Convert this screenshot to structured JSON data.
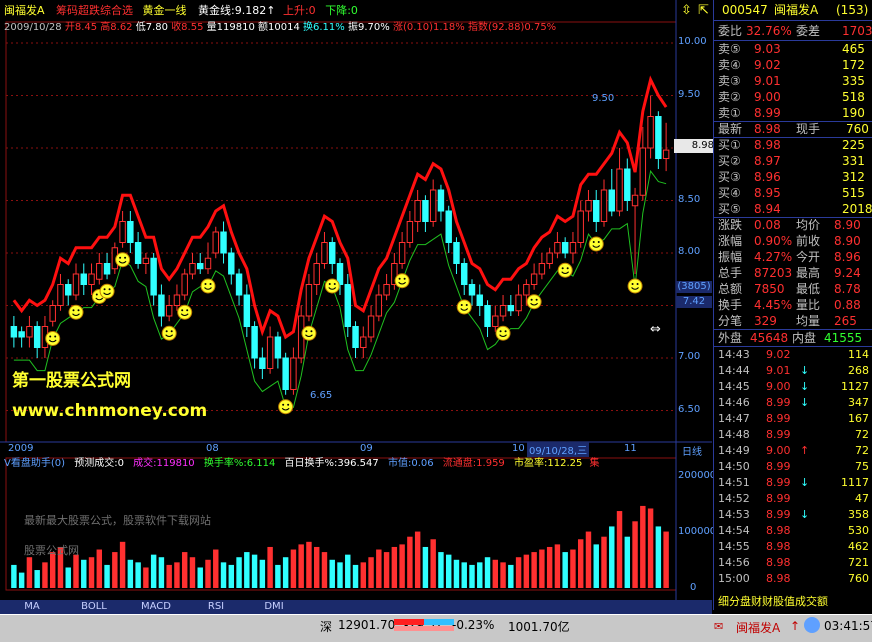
{
  "colors": {
    "up": "#ff3030",
    "down": "#30ffff",
    "flat": "#c0c0c0",
    "yellow": "#ffff30",
    "grid": "#8a1010",
    "border": "#2a3a9a",
    "axis_text": "#5fa0ff"
  },
  "header": {
    "stock": "闽福发A",
    "indicator": "筹码超跌综合选",
    "line_name": "黄金一线",
    "golden_label": "黄金线",
    "golden_value": "9.182",
    "up_label": "上升",
    "up_value": ":0",
    "down_label": "下降",
    "down_value": ":0"
  },
  "bar_info": {
    "date": "2009/10/28",
    "open": "开8.45",
    "high": "高8.62",
    "low": "低7.80",
    "close": "收8.55",
    "volume": "量119810",
    "amount": "额10014",
    "turnover": "换6.11%",
    "amplitude": "振9.70%",
    "change": "涨(0.10)1.18%",
    "index": "指数(92.88)0.75%"
  },
  "price_axis": {
    "labels": [
      "10.00",
      "9.50",
      "9.00",
      "8.50",
      "8.00",
      "7.50",
      "7.00",
      "6.50"
    ],
    "current": "8.98",
    "box1": "(3805)",
    "box2": "7.42"
  },
  "annotations": {
    "high_label": "9.50",
    "low_label": "6.65"
  },
  "watermark": {
    "line1": "第一股票公式网",
    "line2": "www.chnmoney.com",
    "faint1": "最新最大股票公式，股票软件下载网站",
    "faint2": "股票公式网"
  },
  "time_axis": {
    "labels": [
      "2009",
      "08",
      "09",
      "10",
      "09/10/28,三",
      "11"
    ],
    "period": "日线"
  },
  "lower_header": {
    "title": "V看盘助手(0)",
    "forecast": "预测成交:0",
    "volume": "成交:119810",
    "turnover": "换手率%:6.114",
    "hundred_day": "百日换手%:396.547",
    "market_value": "市值:0.06",
    "float_ratio": "流通盘:1.959",
    "pe": "市盈率:112.25",
    "tail": "集"
  },
  "volume_axis": {
    "labels": [
      "200000",
      "100000",
      "0"
    ]
  },
  "indicator_tabs": [
    "MA",
    "BOLL",
    "MACD",
    "RSI",
    "DMI"
  ],
  "right_panel": {
    "code": "000547",
    "name": "闽福发A",
    "code_tag": "(153)",
    "ratio_label": "委比",
    "ratio_value": "32.76%",
    "diff_label": "委差",
    "diff_value": "1703",
    "sells": [
      {
        "label": "卖⑤",
        "price": "9.03",
        "vol": "465"
      },
      {
        "label": "卖④",
        "price": "9.02",
        "vol": "172"
      },
      {
        "label": "卖③",
        "price": "9.01",
        "vol": "335"
      },
      {
        "label": "卖②",
        "price": "9.00",
        "vol": "518"
      },
      {
        "label": "卖①",
        "price": "8.99",
        "vol": "190"
      }
    ],
    "last_label": "最新",
    "last_value": "8.98",
    "hand_label": "现手",
    "hand_value": "760",
    "buys": [
      {
        "label": "买①",
        "price": "8.98",
        "vol": "225"
      },
      {
        "label": "买②",
        "price": "8.97",
        "vol": "331"
      },
      {
        "label": "买③",
        "price": "8.96",
        "vol": "312"
      },
      {
        "label": "买④",
        "price": "8.95",
        "vol": "515"
      },
      {
        "label": "买⑤",
        "price": "8.94",
        "vol": "2018"
      }
    ],
    "stats": [
      {
        "l1": "涨跌",
        "v1": "0.08",
        "l2": "均价",
        "v2": "8.90"
      },
      {
        "l1": "涨幅",
        "v1": "0.90%",
        "l2": "前收",
        "v2": "8.90"
      },
      {
        "l1": "振幅",
        "v1": "4.27%",
        "l2": "今开",
        "v2": "8.96"
      },
      {
        "l1": "总手",
        "v1": "87203",
        "l2": "最高",
        "v2": "9.24"
      },
      {
        "l1": "总额",
        "v1": "7850",
        "l2": "最低",
        "v2": "8.78"
      },
      {
        "l1": "换手",
        "v1": "4.45%",
        "l2": "量比",
        "v2": "0.88"
      },
      {
        "l1": "分笔",
        "v1": "329",
        "l2": "均量",
        "v2": "265"
      }
    ],
    "outer_label": "外盘",
    "outer_value": "45648",
    "inner_label": "内盘",
    "inner_value": "41555",
    "trades": [
      {
        "time": "14:43",
        "price": "9.02",
        "dir": "",
        "vol": "114"
      },
      {
        "time": "14:44",
        "price": "9.01",
        "dir": "↓",
        "vol": "268"
      },
      {
        "time": "14:45",
        "price": "9.00",
        "dir": "↓",
        "vol": "1127"
      },
      {
        "time": "14:46",
        "price": "8.99",
        "dir": "↓",
        "vol": "347"
      },
      {
        "time": "14:47",
        "price": "8.99",
        "dir": "",
        "vol": "167"
      },
      {
        "time": "14:48",
        "price": "8.99",
        "dir": "",
        "vol": "72"
      },
      {
        "time": "14:49",
        "price": "9.00",
        "dir": "↑",
        "vol": "72"
      },
      {
        "time": "14:50",
        "price": "8.99",
        "dir": "",
        "vol": "75"
      },
      {
        "time": "14:51",
        "price": "8.99",
        "dir": "↓",
        "vol": "1117"
      },
      {
        "time": "14:52",
        "price": "8.99",
        "dir": "",
        "vol": "47"
      },
      {
        "time": "14:53",
        "price": "8.99",
        "dir": "↓",
        "vol": "358"
      },
      {
        "time": "14:54",
        "price": "8.98",
        "dir": "",
        "vol": "530"
      },
      {
        "time": "14:55",
        "price": "8.98",
        "dir": "",
        "vol": "462"
      },
      {
        "time": "14:56",
        "price": "8.98",
        "dir": "",
        "vol": "721"
      },
      {
        "time": "15:00",
        "price": "8.98",
        "dir": "",
        "vol": "760"
      }
    ],
    "bottom_tabs": "细分盘财财股值成交额"
  },
  "status": {
    "market": "深",
    "index": "12901.70",
    "change": "-29.51",
    "pct": "-0.23%",
    "amount": "1001.70亿",
    "right_name": "闽福发A",
    "time": "03:41:57"
  },
  "chart_data": {
    "type": "candlestick",
    "price_range": [
      6.2,
      10.2
    ],
    "candles": [
      [
        7.3,
        7.2,
        7.4,
        7.1
      ],
      [
        7.25,
        7.2,
        7.3,
        7.1
      ],
      [
        7.2,
        7.3,
        7.4,
        7.1
      ],
      [
        7.3,
        7.1,
        7.35,
        7.0
      ],
      [
        7.1,
        7.3,
        7.4,
        7.0
      ],
      [
        7.35,
        7.5,
        7.55,
        7.3
      ],
      [
        7.5,
        7.7,
        7.8,
        7.45
      ],
      [
        7.7,
        7.6,
        7.75,
        7.5
      ],
      [
        7.6,
        7.8,
        7.9,
        7.55
      ],
      [
        7.8,
        7.7,
        7.9,
        7.6
      ],
      [
        7.7,
        7.8,
        7.9,
        7.6
      ],
      [
        7.75,
        7.9,
        8.0,
        7.7
      ],
      [
        7.9,
        7.8,
        8.0,
        7.75
      ],
      [
        7.85,
        8.05,
        8.1,
        7.8
      ],
      [
        8.1,
        8.3,
        8.4,
        8.05
      ],
      [
        8.3,
        8.1,
        8.4,
        8.0
      ],
      [
        8.1,
        7.9,
        8.2,
        7.85
      ],
      [
        7.9,
        7.95,
        8.0,
        7.8
      ],
      [
        7.95,
        7.6,
        8.0,
        7.5
      ],
      [
        7.6,
        7.4,
        7.7,
        7.3
      ],
      [
        7.4,
        7.5,
        7.6,
        7.35
      ],
      [
        7.5,
        7.6,
        7.7,
        7.45
      ],
      [
        7.6,
        7.8,
        7.85,
        7.55
      ],
      [
        7.8,
        7.9,
        8.0,
        7.75
      ],
      [
        7.9,
        7.85,
        8.0,
        7.8
      ],
      [
        7.85,
        7.95,
        8.1,
        7.8
      ],
      [
        8.0,
        8.2,
        8.25,
        7.95
      ],
      [
        8.2,
        8.0,
        8.3,
        7.9
      ],
      [
        8.0,
        7.8,
        8.05,
        7.7
      ],
      [
        7.8,
        7.6,
        7.85,
        7.5
      ],
      [
        7.6,
        7.3,
        7.7,
        7.2
      ],
      [
        7.3,
        7.0,
        7.35,
        6.9
      ],
      [
        7.0,
        6.9,
        7.1,
        6.8
      ],
      [
        6.9,
        7.2,
        7.3,
        6.85
      ],
      [
        7.2,
        7.0,
        7.25,
        6.9
      ],
      [
        7.0,
        6.7,
        7.05,
        6.65
      ],
      [
        6.7,
        7.0,
        7.1,
        6.65
      ],
      [
        7.0,
        7.4,
        7.5,
        6.95
      ],
      [
        7.4,
        7.7,
        7.8,
        7.35
      ],
      [
        7.7,
        7.9,
        8.0,
        7.6
      ],
      [
        7.9,
        8.1,
        8.2,
        7.85
      ],
      [
        8.1,
        7.9,
        8.15,
        7.8
      ],
      [
        7.9,
        7.7,
        7.95,
        7.6
      ],
      [
        7.7,
        7.3,
        7.8,
        7.2
      ],
      [
        7.3,
        7.1,
        7.35,
        7.0
      ],
      [
        7.1,
        7.2,
        7.3,
        7.0
      ],
      [
        7.2,
        7.4,
        7.5,
        7.15
      ],
      [
        7.4,
        7.6,
        7.7,
        7.35
      ],
      [
        7.6,
        7.7,
        7.8,
        7.55
      ],
      [
        7.7,
        7.9,
        8.0,
        7.65
      ],
      [
        7.9,
        8.1,
        8.2,
        7.85
      ],
      [
        8.1,
        8.3,
        8.4,
        8.05
      ],
      [
        8.3,
        8.5,
        8.6,
        8.2
      ],
      [
        8.5,
        8.3,
        8.55,
        8.2
      ],
      [
        8.3,
        8.6,
        8.7,
        8.25
      ],
      [
        8.6,
        8.4,
        8.65,
        8.3
      ],
      [
        8.4,
        8.1,
        8.45,
        8.0
      ],
      [
        8.1,
        7.9,
        8.15,
        7.8
      ],
      [
        7.9,
        7.7,
        7.95,
        7.6
      ],
      [
        7.7,
        7.6,
        7.75,
        7.5
      ],
      [
        7.6,
        7.5,
        7.7,
        7.4
      ],
      [
        7.5,
        7.3,
        7.55,
        7.2
      ],
      [
        7.3,
        7.4,
        7.5,
        7.25
      ],
      [
        7.4,
        7.5,
        7.6,
        7.35
      ],
      [
        7.5,
        7.45,
        7.6,
        7.4
      ],
      [
        7.45,
        7.6,
        7.7,
        7.4
      ],
      [
        7.6,
        7.7,
        7.75,
        7.5
      ],
      [
        7.7,
        7.8,
        7.9,
        7.65
      ],
      [
        7.8,
        7.9,
        8.0,
        7.75
      ],
      [
        7.9,
        8.0,
        8.05,
        7.85
      ],
      [
        8.0,
        8.1,
        8.2,
        7.95
      ],
      [
        8.1,
        8.0,
        8.15,
        7.95
      ],
      [
        8.0,
        8.1,
        8.2,
        7.9
      ],
      [
        8.1,
        8.4,
        8.5,
        8.05
      ],
      [
        8.4,
        8.5,
        8.6,
        8.3
      ],
      [
        8.5,
        8.3,
        8.6,
        8.2
      ],
      [
        8.3,
        8.6,
        8.7,
        8.25
      ],
      [
        8.6,
        8.4,
        8.8,
        8.35
      ],
      [
        8.4,
        8.8,
        9.0,
        8.35
      ],
      [
        8.8,
        8.5,
        8.9,
        8.4
      ],
      [
        8.45,
        8.55,
        8.62,
        7.8
      ],
      [
        8.55,
        9.0,
        9.2,
        8.5
      ],
      [
        9.0,
        9.3,
        9.5,
        8.9
      ],
      [
        9.3,
        8.9,
        9.35,
        8.8
      ],
      [
        8.9,
        8.98,
        9.24,
        8.78
      ]
    ],
    "volumes": [
      45,
      30,
      60,
      35,
      50,
      70,
      80,
      40,
      65,
      55,
      60,
      75,
      45,
      70,
      90,
      55,
      50,
      40,
      65,
      60,
      45,
      50,
      70,
      60,
      40,
      55,
      75,
      50,
      45,
      60,
      70,
      65,
      55,
      80,
      45,
      60,
      75,
      85,
      90,
      80,
      70,
      55,
      50,
      65,
      45,
      50,
      60,
      75,
      70,
      80,
      85,
      100,
      110,
      80,
      95,
      70,
      65,
      55,
      50,
      45,
      50,
      60,
      55,
      50,
      45,
      60,
      65,
      70,
      75,
      80,
      85,
      70,
      75,
      95,
      110,
      85,
      100,
      120,
      150,
      100,
      130,
      160,
      155,
      120,
      110
    ],
    "volume_range": [
      0,
      230
    ]
  }
}
